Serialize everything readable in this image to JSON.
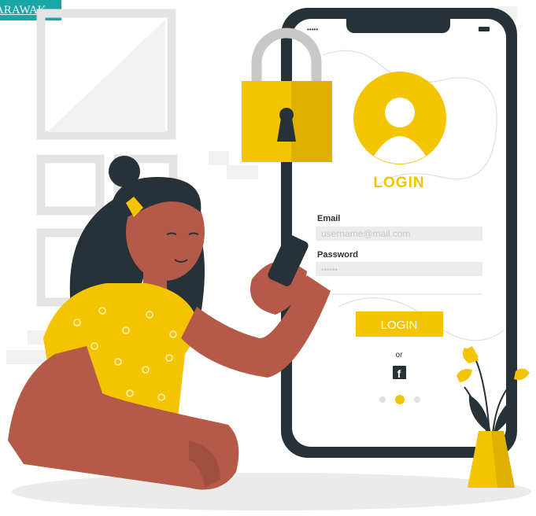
{
  "badge_text": "ARAWAK",
  "phone": {
    "status_signal": "•••••",
    "login_title": "LOGIN",
    "email_label": "Email",
    "email_placeholder": "username@mail.com",
    "password_label": "Password",
    "password_value": "••••••",
    "login_button": "LOGIN",
    "or_text": "or",
    "facebook_glyph": "f"
  },
  "colors": {
    "accent": "#f5c400",
    "dark": "#263238",
    "skin": "#b55a48",
    "screen": "#ffffff",
    "field": "#ececec"
  }
}
